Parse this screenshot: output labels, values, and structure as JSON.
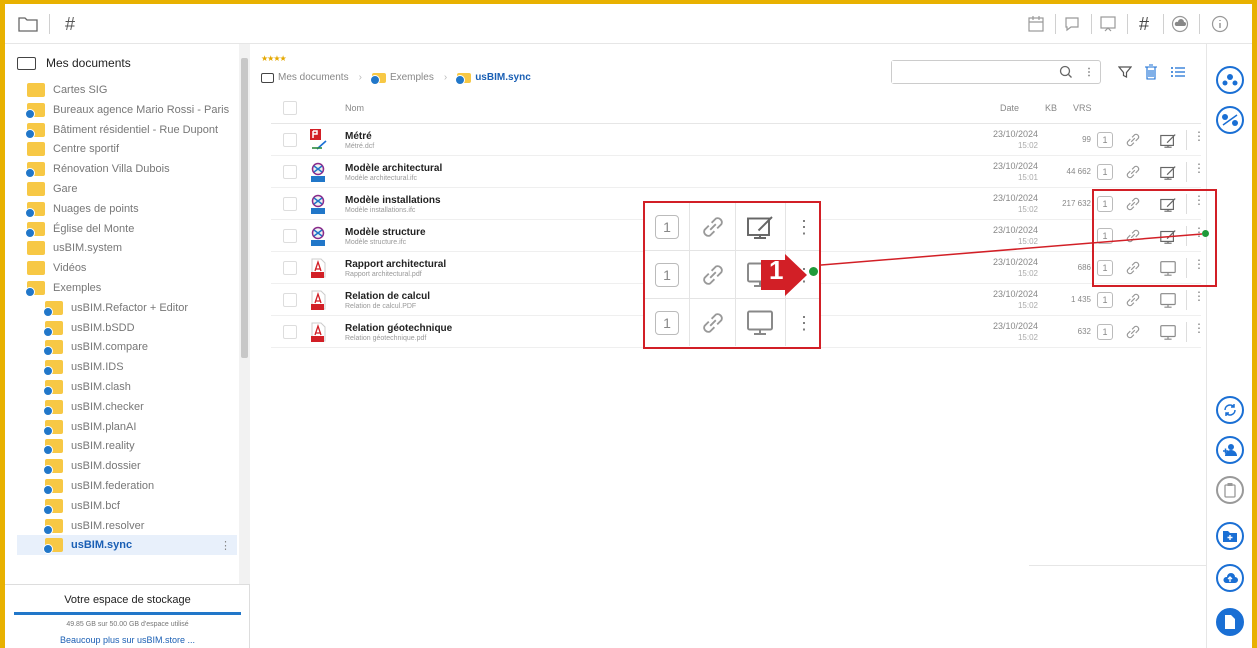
{
  "sidebar": {
    "root_label": "Mes documents",
    "items": [
      {
        "label": "Cartes SIG",
        "type": "y"
      },
      {
        "label": "Bureaux agence Mario Rossi - Paris",
        "type": "b"
      },
      {
        "label": "Bâtiment résidentiel - Rue Dupont",
        "type": "b"
      },
      {
        "label": "Centre sportif",
        "type": "y"
      },
      {
        "label": "Rénovation Villa Dubois",
        "type": "b"
      },
      {
        "label": "Gare",
        "type": "y"
      },
      {
        "label": "Nuages de points",
        "type": "b"
      },
      {
        "label": "Église del Monte",
        "type": "b"
      },
      {
        "label": "usBIM.system",
        "type": "y"
      },
      {
        "label": "Vidéos",
        "type": "y"
      },
      {
        "label": "Exemples",
        "type": "b"
      }
    ],
    "sub_items": [
      {
        "label": "usBIM.Refactor + Editor"
      },
      {
        "label": "usBIM.bSDD"
      },
      {
        "label": "usBIM.compare"
      },
      {
        "label": "usBIM.IDS"
      },
      {
        "label": "usBIM.clash"
      },
      {
        "label": "usBIM.checker"
      },
      {
        "label": "usBIM.planAI"
      },
      {
        "label": "usBIM.reality"
      },
      {
        "label": "usBIM.dossier"
      },
      {
        "label": "usBIM.federation"
      },
      {
        "label": "usBIM.bcf"
      },
      {
        "label": "usBIM.resolver"
      }
    ],
    "selected_label": "usBIM.sync",
    "storage": {
      "title": "Votre espace de stockage",
      "usage": "49.85 GB sur 50.00 GB d'espace utilisé",
      "usage_fraction": 0.997,
      "link": "Beaucoup plus sur usBIM.store ..."
    }
  },
  "breadcrumb": {
    "stars": "★★★★",
    "items": [
      "Mes documents",
      "Exemples",
      "usBIM.sync"
    ]
  },
  "search": {
    "placeholder": ""
  },
  "columns": {
    "name": "Nom",
    "date": "Date",
    "kb": "KB",
    "vrs": "VRS"
  },
  "files": [
    {
      "name": "Métré",
      "file": "Métré.dcf",
      "date": "23/10/2024",
      "time": "15:02",
      "kb": "99",
      "vrs": "1",
      "kind": "dcf",
      "edit": true
    },
    {
      "name": "Modèle architectural",
      "file": "Modèle architectural.ifc",
      "date": "23/10/2024",
      "time": "15:01",
      "kb": "44 662",
      "vrs": "1",
      "kind": "ifc",
      "edit": true
    },
    {
      "name": "Modèle installations",
      "file": "Modèle installations.ifc",
      "date": "23/10/2024",
      "time": "15:02",
      "kb": "217 632",
      "vrs": "1",
      "kind": "ifc",
      "edit": true
    },
    {
      "name": "Modèle structure",
      "file": "Modèle structure.ifc",
      "date": "23/10/2024",
      "time": "15:02",
      "kb": "",
      "vrs": "1",
      "kind": "ifc",
      "edit": true
    },
    {
      "name": "Rapport architectural",
      "file": "Rapport architectural.pdf",
      "date": "23/10/2024",
      "time": "15:02",
      "kb": "686",
      "vrs": "1",
      "kind": "pdf",
      "edit": false
    },
    {
      "name": "Relation de calcul",
      "file": "Relation de calcul.PDF",
      "date": "23/10/2024",
      "time": "15:02",
      "kb": "1 435",
      "vrs": "1",
      "kind": "pdf",
      "edit": false
    },
    {
      "name": "Relation géotechnique",
      "file": "Relation géotechnique.pdf",
      "date": "23/10/2024",
      "time": "15:02",
      "kb": "632",
      "vrs": "1",
      "kind": "pdf",
      "edit": false
    }
  ],
  "zoom_rows": [
    {
      "vrs": "1",
      "edit": true
    },
    {
      "vrs": "1",
      "edit": false
    },
    {
      "vrs": "1",
      "edit": false
    }
  ],
  "callout": {
    "number": "1"
  },
  "colors": {
    "accent": "#1a6fd4",
    "highlight": "#d21f26",
    "frame": "#e8b100",
    "dot": "#1f9a3a"
  }
}
